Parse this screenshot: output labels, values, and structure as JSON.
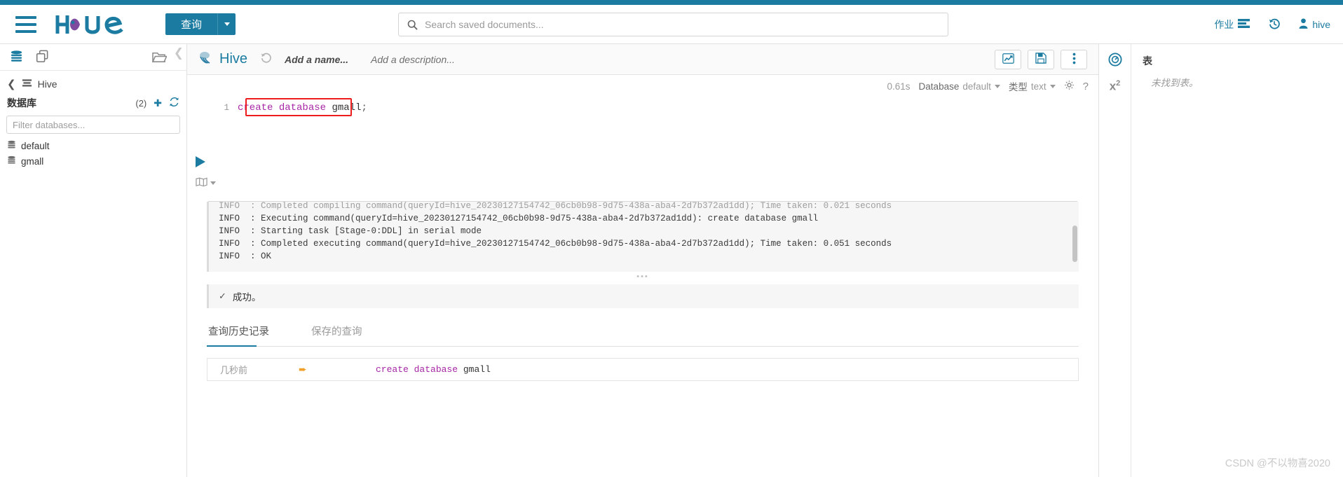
{
  "navbar": {
    "menu_icon": "hamburger-icon",
    "logo_text": "hue",
    "query_button": "查询",
    "query_caret": "chevron-down-icon",
    "search_placeholder": "Search saved documents...",
    "search_value": "",
    "search_icon": "search-icon",
    "jobs_label": "作业",
    "jobs_icon": "jobs-list-icon",
    "history_icon": "history-clock-icon",
    "user_label": "hive",
    "user_icon": "user-icon"
  },
  "left_panel": {
    "toolbar": {
      "db_icon": "database-icon",
      "docs_icon": "documents-icon",
      "folder_icon": "folder-icon",
      "collapse_icon": "chevron-left-icon"
    },
    "source_label": "Hive",
    "source_icon": "hive-source-icon",
    "back_icon": "chevron-left-icon",
    "databases_label": "数据库",
    "databases_count": "(2)",
    "add_icon": "plus-icon",
    "refresh_icon": "refresh-icon",
    "filter_placeholder": "Filter databases...",
    "filter_value": "",
    "databases": [
      {
        "name": "default",
        "icon": "database-icon"
      },
      {
        "name": "gmall",
        "icon": "database-icon"
      }
    ]
  },
  "editor": {
    "app_name": "Hive",
    "app_icon": "hive-logo-icon",
    "history_icon": "history-revert-icon",
    "name_placeholder": "Add a name...",
    "description_placeholder": "Add a description...",
    "chart_button_icon": "chart-line-icon",
    "save_button_icon": "floppy-save-icon",
    "more_button_icon": "vertical-ellipsis-icon",
    "exec_time": "0.61s",
    "database_label": "Database",
    "database_value": "default",
    "type_label": "类型",
    "type_value": "text",
    "settings_icon": "gear-icon",
    "help_icon": "question-mark-icon",
    "run_icon": "play-triangle-icon",
    "book_icon": "book-icon",
    "book_caret_icon": "chevron-down-icon",
    "line_number": "1",
    "sql_tokens": [
      {
        "text": "create",
        "type": "kw"
      },
      {
        "text": " ",
        "type": "punct"
      },
      {
        "text": "database",
        "type": "kw"
      },
      {
        "text": " ",
        "type": "punct"
      },
      {
        "text": "gmall",
        "type": "ident"
      },
      {
        "text": ";",
        "type": "punct"
      }
    ],
    "highlight_color": "#ee1c1c"
  },
  "log": {
    "drag_handle": "•••",
    "lines": [
      "INFO  : Completed compiling command(queryId=hive_20230127154742_06cb0b98-9d75-438a-aba4-2d7b372ad1dd); Time taken: 0.021 seconds",
      "INFO  : Executing command(queryId=hive_20230127154742_06cb0b98-9d75-438a-aba4-2d7b372ad1dd): create database gmall",
      "INFO  : Starting task [Stage-0:DDL] in serial mode",
      "INFO  : Completed executing command(queryId=hive_20230127154742_06cb0b98-9d75-438a-aba4-2d7b372ad1dd); Time taken: 0.051 seconds",
      "INFO  : OK"
    ]
  },
  "status": {
    "check_icon": "check-icon",
    "message": "成功。"
  },
  "tabs": [
    {
      "label": "查询历史记录",
      "active": true
    },
    {
      "label": "保存的查询",
      "active": false
    }
  ],
  "history": [
    {
      "time": "几秒前",
      "pin_icon": "pin-icon",
      "sql_tokens": [
        {
          "text": "create",
          "type": "kw"
        },
        {
          "text": " ",
          "type": "punct"
        },
        {
          "text": "database",
          "type": "kw"
        },
        {
          "text": " ",
          "type": "punct"
        },
        {
          "text": "gmall",
          "type": "ident"
        }
      ]
    }
  ],
  "right_panel": {
    "assist_icon": "target-circle-icon",
    "functions_icon": "x-squared-icon",
    "title": "表",
    "empty_message": "未找到表。"
  },
  "watermark": "CSDN @不以物喜2020",
  "colors": {
    "accent": "#1b7ba0",
    "highlight": "#ee1c1c",
    "keyword": "#a626a4",
    "panel_bg": "#f6f6f6"
  }
}
